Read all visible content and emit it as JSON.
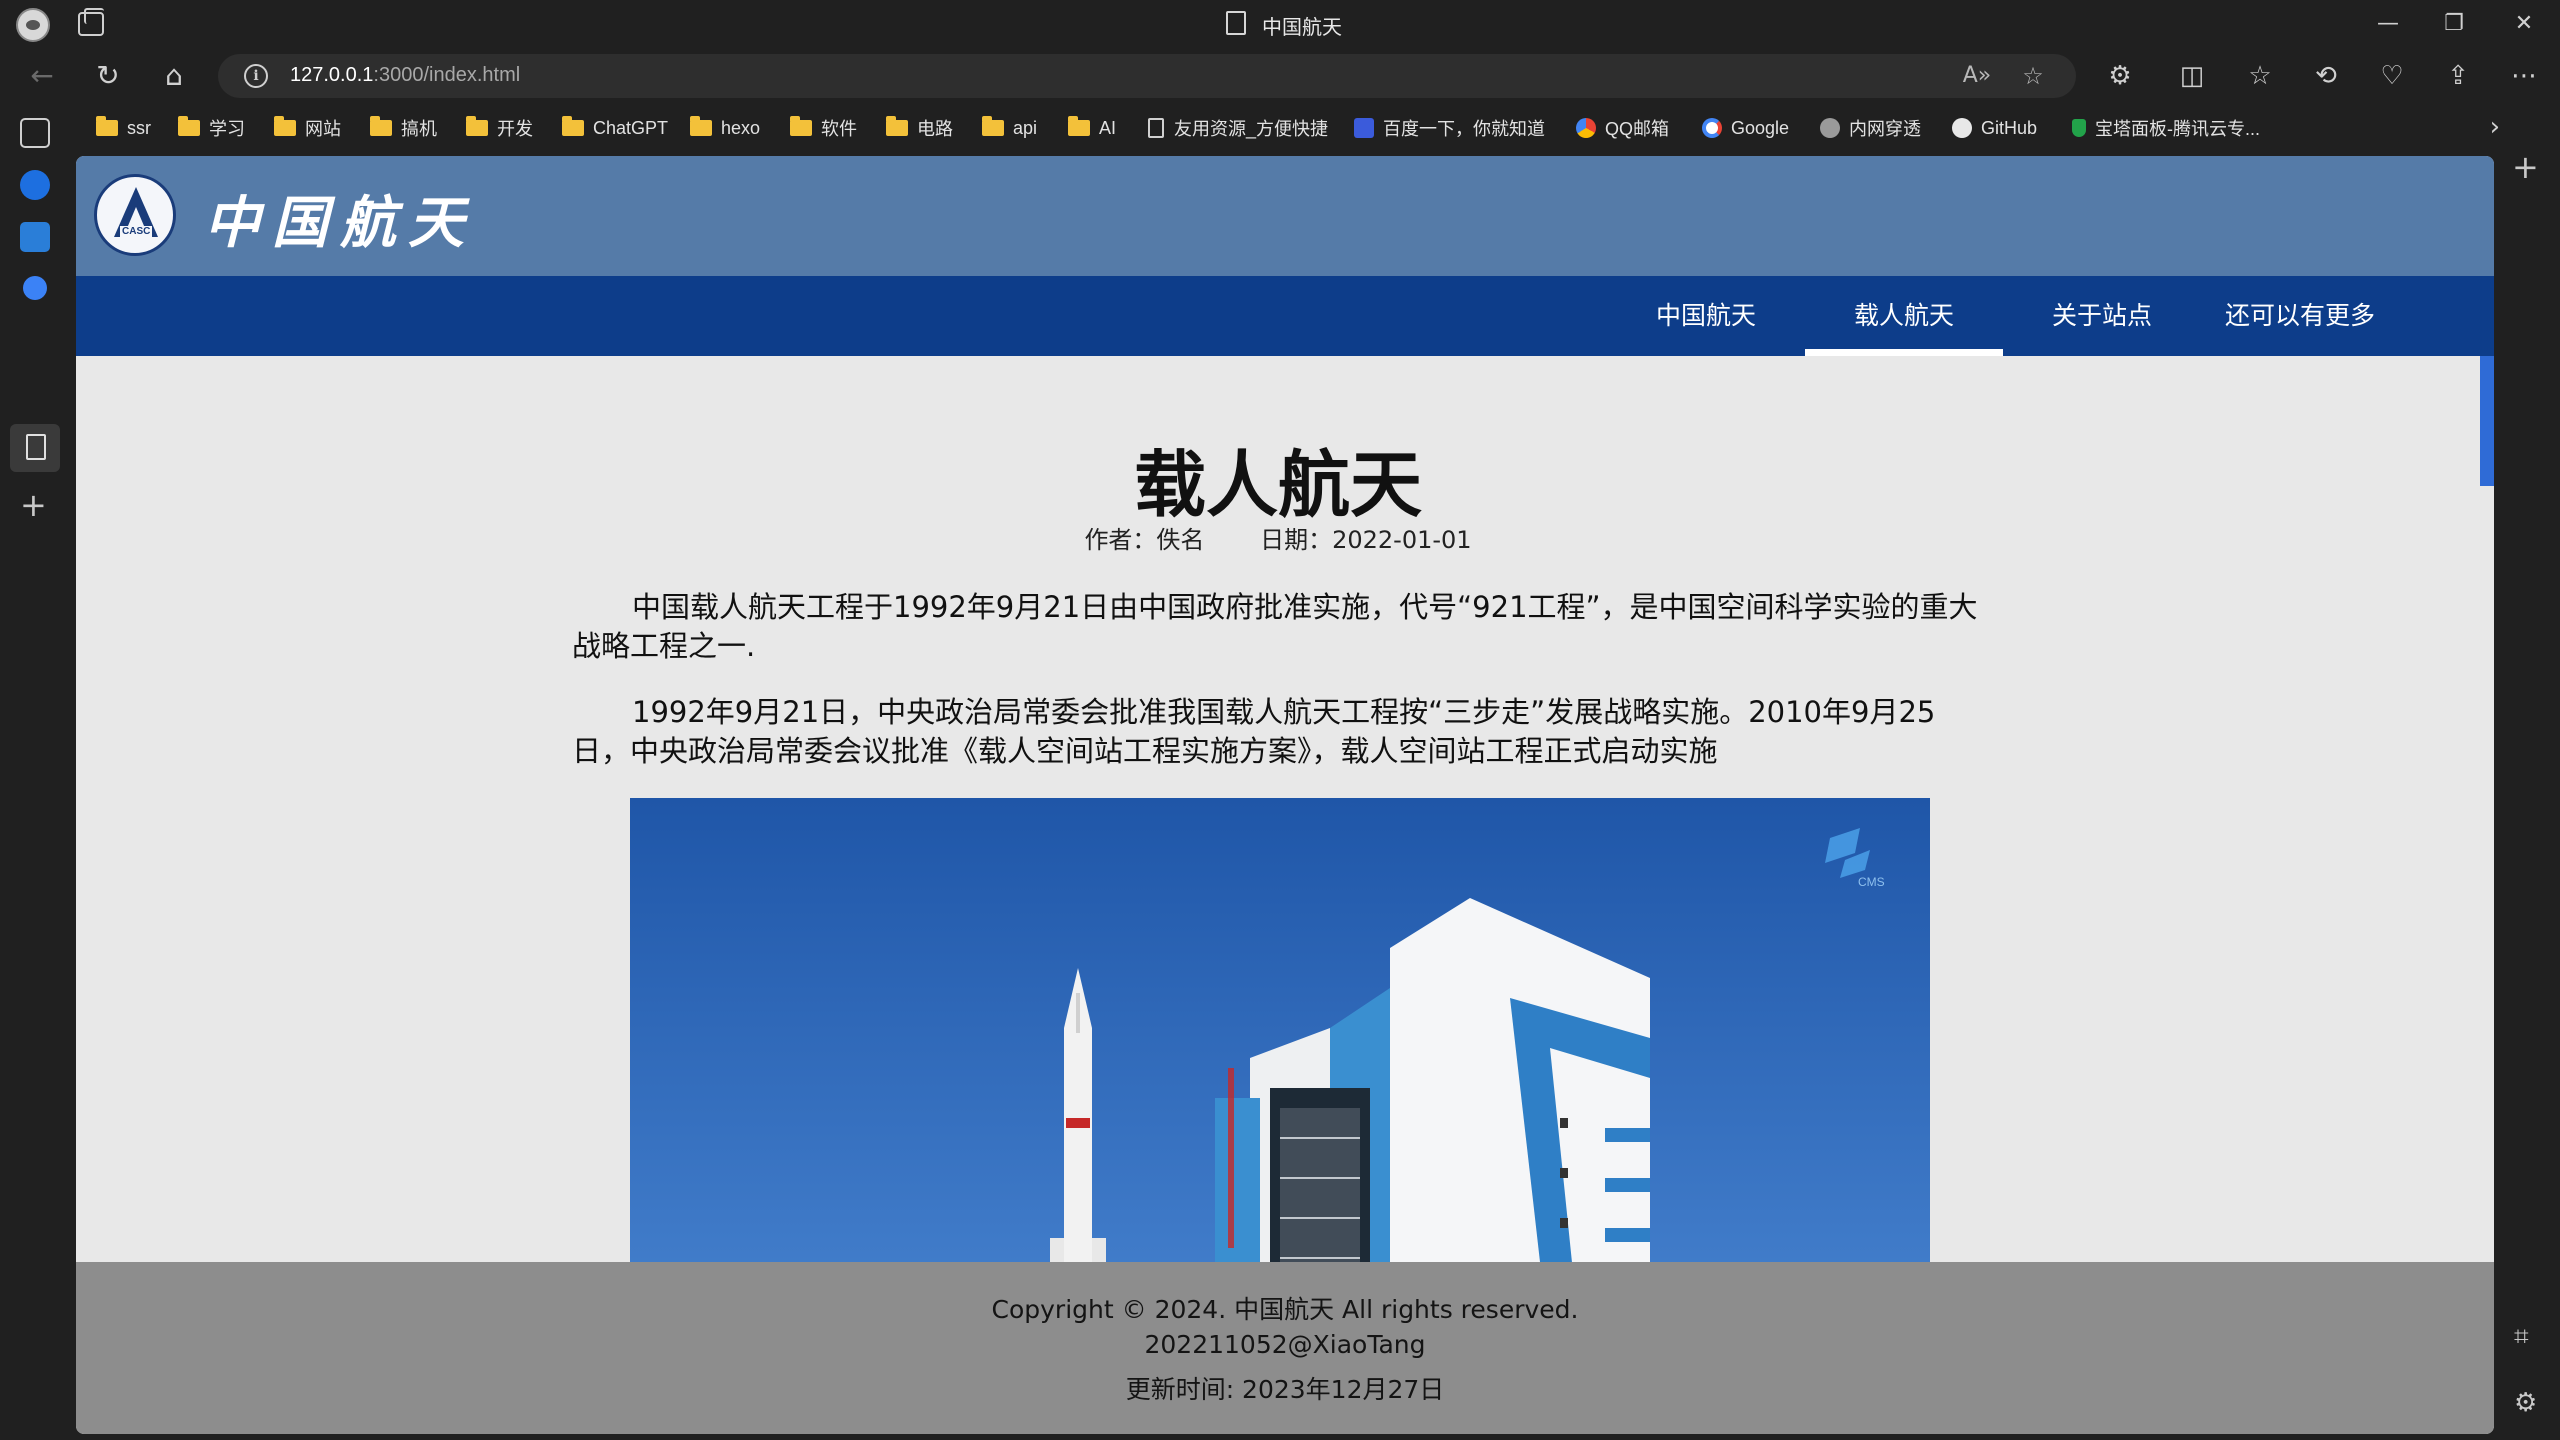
{
  "browser": {
    "window_title": "中国航天",
    "url_host": "127.0.0.1",
    "url_rest": ":3000/index.html",
    "bookmarks": [
      {
        "label": "ssr",
        "type": "folder"
      },
      {
        "label": "学习",
        "type": "folder"
      },
      {
        "label": "网站",
        "type": "folder"
      },
      {
        "label": "搞机",
        "type": "folder"
      },
      {
        "label": "开发",
        "type": "folder"
      },
      {
        "label": "ChatGPT",
        "type": "folder"
      },
      {
        "label": "hexo",
        "type": "folder"
      },
      {
        "label": "软件",
        "type": "folder"
      },
      {
        "label": "电路",
        "type": "folder"
      },
      {
        "label": "api",
        "type": "folder"
      },
      {
        "label": "AI",
        "type": "folder"
      },
      {
        "label": "友用资源_方便快捷",
        "type": "page"
      },
      {
        "label": "百度一下，你就知道",
        "type": "site"
      },
      {
        "label": "QQ邮箱",
        "type": "site"
      },
      {
        "label": "Google",
        "type": "site"
      },
      {
        "label": "内网穿透",
        "type": "site"
      },
      {
        "label": "GitHub",
        "type": "site"
      },
      {
        "label": "宝塔面板-腾讯云专...",
        "type": "site"
      }
    ]
  },
  "site": {
    "logo_text": "CASC",
    "name": "中国航天",
    "nav": [
      {
        "label": "中国航天",
        "active": false
      },
      {
        "label": "载人航天",
        "active": true
      },
      {
        "label": "关于站点",
        "active": false
      },
      {
        "label": "还可以有更多",
        "active": false
      }
    ]
  },
  "article": {
    "title": "载人航天",
    "author": "作者：佚名",
    "date": "日期：2022-01-01",
    "paragraphs": [
      "中国载人航天工程于1992年9月21日由中国政府批准实施，代号“921工程”，是中国空间科学实验的重大战略工程之一.",
      "1992年9月21日，中央政治局常委会批准我国载人航天工程按“三步走”发展战略实施。2010年9月25日，中央政治局常委会议批准《载人空间站工程实施方案》，载人空间站工程正式启动实施"
    ],
    "image_watermark": "CMS"
  },
  "footer": {
    "copyright": "Copyright © 2024. 中国航天 All rights reserved.",
    "author": "202211052@XiaoTang",
    "updated": "更新时间: 2023年12月27日"
  },
  "colors": {
    "header": "#557ba8",
    "nav": "#0d3d8a",
    "footer": "#8d8d8d",
    "sky": "#2a62b8"
  }
}
